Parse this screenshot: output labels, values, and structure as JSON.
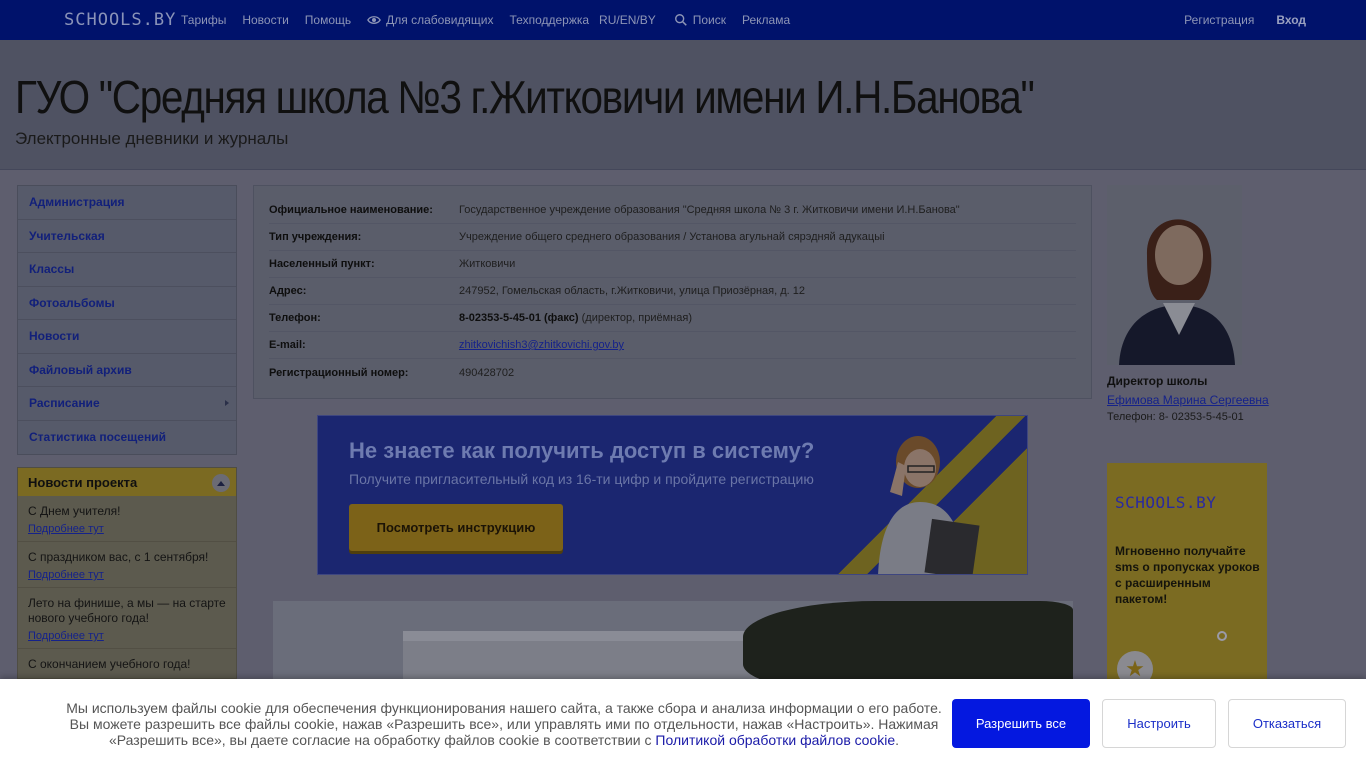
{
  "topnav": {
    "logo": "SCHOOLS.BY",
    "items": [
      "Тарифы",
      "Новости",
      "Помощь",
      "Для слабовидящих",
      "Техподдержка",
      "RU/EN/BY",
      "Поиск",
      "Реклама"
    ],
    "register": "Регистрация",
    "login": "Вход"
  },
  "header": {
    "title": "ГУО \"Средняя школа №3 г.Житковичи имени И.Н.Банова\"",
    "subtitle": "Электронные дневники и журналы"
  },
  "sidebar": {
    "items": [
      {
        "label": "Администрация"
      },
      {
        "label": "Учительская"
      },
      {
        "label": "Классы"
      },
      {
        "label": "Фотоальбомы"
      },
      {
        "label": "Новости"
      },
      {
        "label": "Файловый архив"
      },
      {
        "label": "Расписание"
      },
      {
        "label": "Статистика посещений"
      }
    ]
  },
  "project_news": {
    "title": "Новости проекта",
    "more_label": "Подробнее тут",
    "entries": [
      {
        "title": "С Днем учителя!"
      },
      {
        "title": "С праздником вас, с 1 сентября!"
      },
      {
        "title": "Лето на финише, а мы — на старте нового учебного года!"
      },
      {
        "title": "С окончанием учебного года!"
      }
    ]
  },
  "info": {
    "rows": [
      {
        "key": "Официальное наименование:",
        "value": "Государственное учреждение образования \"Средняя школа № 3 г. Житковичи имени И.Н.Банова\""
      },
      {
        "key": "Тип учреждения:",
        "value": "Учреждение общего среднего образования / Установа агульнай сярэдняй адукацыі"
      },
      {
        "key": "Населенный пункт:",
        "value": "Житковичи"
      },
      {
        "key": "Адрес:",
        "value": "247952, Гомельская область, г.Житковичи, улица Приозёрная, д. 12"
      },
      {
        "key": "Телефон:",
        "value_bold": "8-02353-5-45-01 (факс)",
        "value": " (директор, приёмная)"
      },
      {
        "key": "E-mail:",
        "link": "zhitkovichish3@zhitkovichi.gov.by"
      },
      {
        "key": "Регистрационный номер:",
        "value": "490428702"
      }
    ]
  },
  "banner": {
    "heading": "Не знаете как получить доступ в систему?",
    "subheading": "Получите пригласительный код из 16-ти цифр и пройдите регистрацию",
    "button": "Посмотреть инструкцию"
  },
  "director": {
    "label": "Директор школы",
    "name": "Ефимова Марина Сергеевна",
    "phone": "Телефон: 8- 02353-5-45-01"
  },
  "ad": {
    "logo": "SCHOOLS.BY",
    "text": "Мгновенно получайте sms о пропусках уроков с расширенным пакетом!"
  },
  "cookie": {
    "text": "Мы используем файлы cookie для обеспечения функционирования нашего сайта, а также сбора и анализа информации о его работе. Вы можете разрешить все файлы cookie, нажав «Разрешить все», или управлять ими по отдельности, нажав «Настроить». Нажимая «Разрешить все», вы даете согласие на обработку файлов cookie в соответствии с ",
    "link": "Политикой обработки файлов cookie",
    "tail": ".",
    "allow": "Разрешить все",
    "configure": "Настроить",
    "refuse": "Отказаться"
  },
  "colors": {
    "nav_bg": "#00126b",
    "link": "#15228a",
    "accent": "#f5c400",
    "allow_button": "#0418e0"
  }
}
